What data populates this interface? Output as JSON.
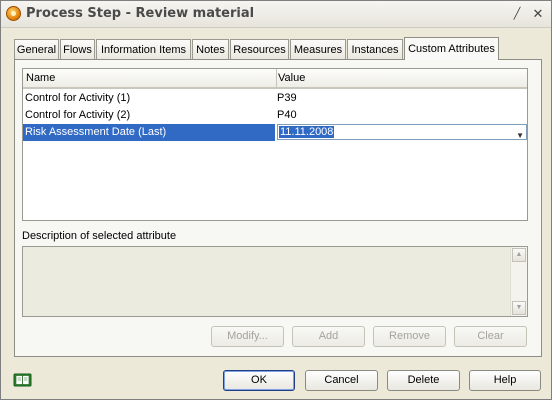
{
  "window": {
    "title": "Process Step - Review material"
  },
  "tabs": [
    {
      "label": "General"
    },
    {
      "label": "Flows"
    },
    {
      "label": "Information Items"
    },
    {
      "label": "Notes"
    },
    {
      "label": "Resources"
    },
    {
      "label": "Measures"
    },
    {
      "label": "Instances"
    },
    {
      "label": "Custom Attributes",
      "active": true
    }
  ],
  "grid": {
    "columns": [
      "Name",
      "Value"
    ],
    "rows": [
      {
        "name": "Control for Activity (1)",
        "value": "P39"
      },
      {
        "name": "Control for Activity (2)",
        "value": "P40"
      },
      {
        "name": "Risk Assessment Date (Last)",
        "value": "11.11.2008",
        "selected": true
      }
    ]
  },
  "description": {
    "label": "Description of selected attribute",
    "text": ""
  },
  "attribute_buttons": {
    "modify": "Modify...",
    "add": "Add",
    "remove": "Remove",
    "clear": "Clear"
  },
  "dialog_buttons": {
    "ok": "OK",
    "cancel": "Cancel",
    "delete": "Delete",
    "help": "Help"
  },
  "colors": {
    "selection": "#316ac5",
    "dialog_bg": "#ece9d8"
  }
}
